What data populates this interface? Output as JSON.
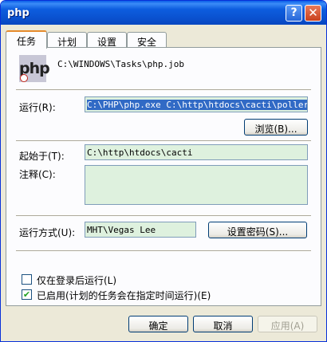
{
  "window": {
    "title": "php",
    "help_glyph": "?",
    "close_glyph": "✕"
  },
  "tabs": [
    {
      "label": "任务",
      "active": true
    },
    {
      "label": "计划",
      "active": false
    },
    {
      "label": "设置",
      "active": false
    },
    {
      "label": "安全",
      "active": false
    }
  ],
  "job": {
    "icon_text": "php",
    "path": "C:\\WINDOWS\\Tasks\\php.job"
  },
  "run": {
    "label": "运行(R):",
    "value": "C:\\PHP\\php.exe C:\\http\\htdocs\\cacti\\poller.php",
    "browse_label": "浏览(B)..."
  },
  "start_in": {
    "label": "起始于(T):",
    "value": "C:\\http\\htdocs\\cacti"
  },
  "comments": {
    "label": "注释(C):",
    "value": ""
  },
  "run_as": {
    "label": "运行方式(U):",
    "value": "MHT\\Vegas Lee",
    "set_password_label": "设置密码(S)..."
  },
  "options": {
    "only_logged_on": {
      "label": "仅在登录后运行(L)",
      "checked": false
    },
    "enabled": {
      "label": "已启用(计划的任务会在指定时间运行)(E)",
      "checked": true,
      "check_glyph": "✔"
    }
  },
  "buttons": {
    "ok": "确定",
    "cancel": "取消",
    "apply": "应用(A)"
  },
  "colors": {
    "accent": "#0a52d0",
    "selection": "#316ac5",
    "field_bg": "#def1de"
  }
}
